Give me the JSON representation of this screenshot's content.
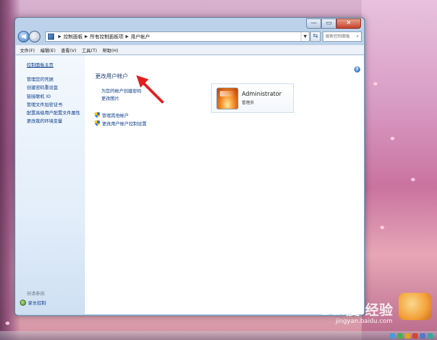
{
  "window": {
    "title_buttons": {
      "minimize": "—",
      "maximize": "▭",
      "close": "✕"
    }
  },
  "navigation": {
    "back": "◀",
    "forward": "▶",
    "breadcrumb": [
      "控制面板",
      "所有控制面板项",
      "用户帐户"
    ],
    "search_placeholder": "搜索控制面板"
  },
  "menu": [
    "文件(F)",
    "编辑(E)",
    "查看(V)",
    "工具(T)",
    "帮助(H)"
  ],
  "sidebar": {
    "home": "控制面板主页",
    "links": [
      "管理您的凭据",
      "创建密码重设盘",
      "链接联机 ID",
      "管理文件加密证书",
      "配置高级用户配置文件属性",
      "更改我的环境变量"
    ],
    "see_also_title": "另请参阅",
    "see_also": [
      {
        "label": "家长控制",
        "icon": "parental-control-icon"
      }
    ]
  },
  "main": {
    "heading": "更改用户帐户",
    "links": [
      "为您的帐户创建密码",
      "更改图片"
    ],
    "shield_links": [
      "管理其他帐户",
      "更改用户帐户控制设置"
    ]
  },
  "account": {
    "name": "Administrator",
    "role": "管理员"
  },
  "watermark": {
    "brand": "Bai度 经验",
    "url": "jingyan.baidu.com"
  },
  "colors": {
    "link": "#0c3d8a",
    "heading": "#1c3f73",
    "arrow": "#e02020"
  }
}
